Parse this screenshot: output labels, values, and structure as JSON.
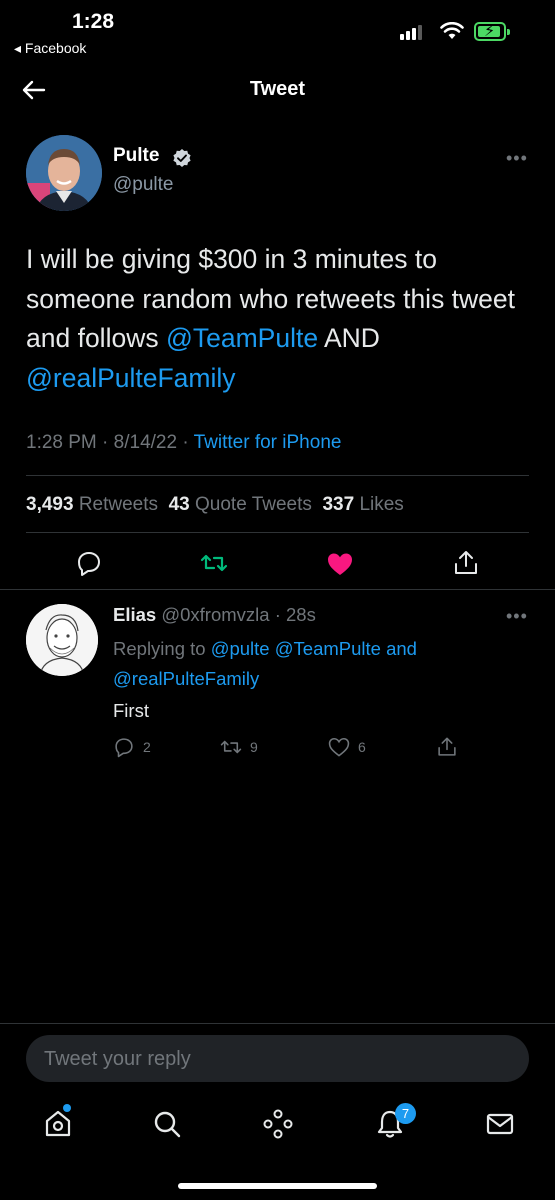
{
  "status_bar": {
    "time": "1:28",
    "back_app": "◂ Facebook"
  },
  "header": {
    "title": "Tweet"
  },
  "tweet": {
    "author_name": "Pulte",
    "author_handle": "@pulte",
    "text_1": "I will be giving $300 in 3 minutes to someone random who retweets this tweet and follows ",
    "mention_1": "@TeamPulte",
    "text_2": " AND ",
    "mention_2": "@realPulteFamily",
    "time": "1:28 PM",
    "date": "8/14/22",
    "source": "Twitter for iPhone",
    "retweets_count": "3,493",
    "retweets_label": "Retweets",
    "quotes_count": "43",
    "quotes_label": "Quote Tweets",
    "likes_count": "337",
    "likes_label": "Likes"
  },
  "reply": {
    "author_name": "Elias",
    "author_handle": "@0xfromvzla",
    "age": "28s",
    "replying_label": "Replying to",
    "mention_1": "@pulte",
    "mention_2": "@TeamPulte",
    "and_label": "and",
    "mention_3": "@realPulteFamily",
    "text": "First",
    "reply_count": "2",
    "retweet_count": "9",
    "like_count": "6"
  },
  "composer": {
    "placeholder": "Tweet your reply"
  },
  "tab_bar": {
    "notifications_badge": "7"
  },
  "colors": {
    "accent": "#1d9bf0",
    "retweet_active": "#00ba7c",
    "like_active": "#f91880",
    "background": "#000000"
  }
}
